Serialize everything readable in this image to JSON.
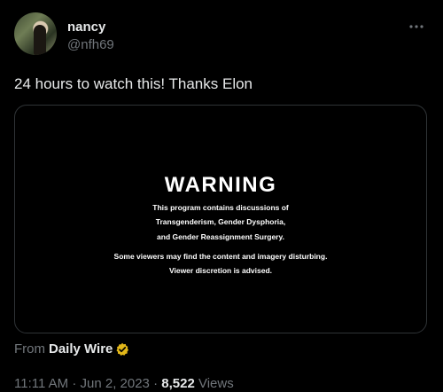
{
  "author": {
    "display_name": "nancy",
    "handle": "@nfh69"
  },
  "tweet": {
    "text": "24 hours to watch this! Thanks Elon"
  },
  "media": {
    "warning_title": "WARNING",
    "warning_lines": [
      "This program contains discussions of",
      "Transgenderism, Gender Dysphoria,",
      "and Gender Reassignment Surgery.",
      "Some viewers may find the content and imagery disturbing.",
      "Viewer discretion is advised."
    ]
  },
  "source": {
    "from_label": "From",
    "name": "Daily Wire",
    "badge_color": "#e2b719"
  },
  "meta": {
    "time": "11:11 AM",
    "separator": " · ",
    "date": "Jun 2, 2023",
    "views_count": "8,522",
    "views_label": "Views"
  },
  "icons": {
    "more": "more-horizontal-icon",
    "badge": "verified-badge-icon"
  }
}
